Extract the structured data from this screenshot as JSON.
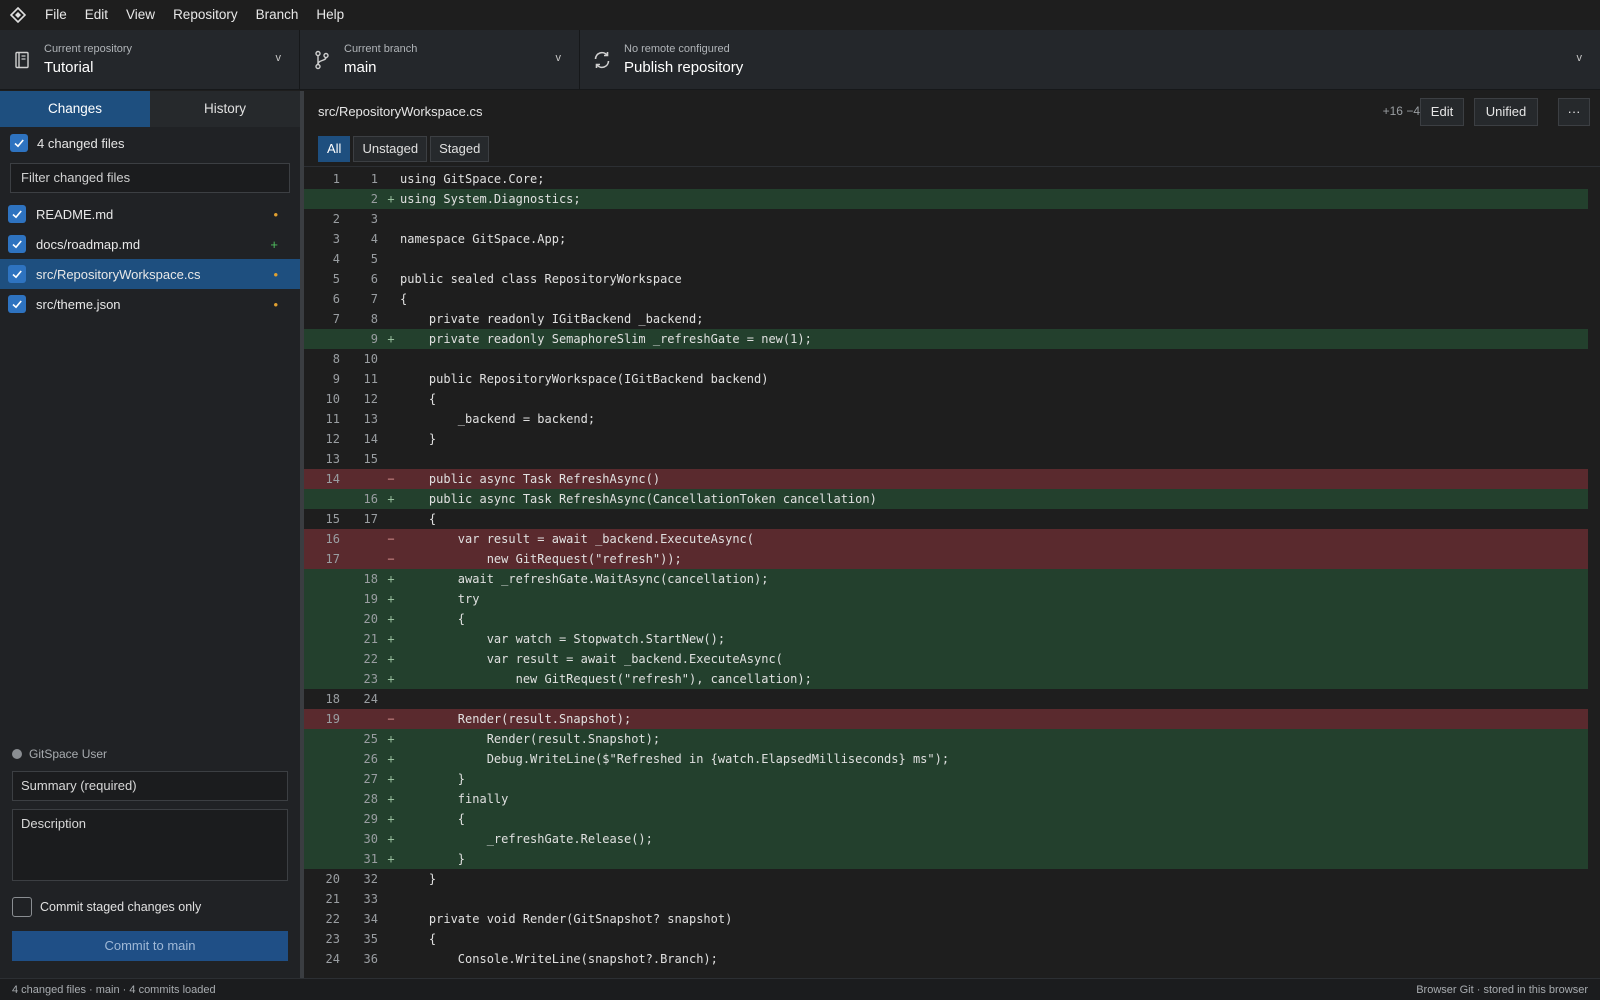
{
  "menu": [
    "File",
    "Edit",
    "View",
    "Repository",
    "Branch",
    "Help"
  ],
  "toolbar": {
    "repo": {
      "caption": "Current repository",
      "value": "Tutorial",
      "chevron": "v"
    },
    "branch": {
      "caption": "Current branch",
      "value": "main",
      "chevron": "v"
    },
    "publish": {
      "caption": "No remote configured",
      "value": "Publish repository",
      "chevron": "v"
    }
  },
  "sidebar": {
    "tabs": [
      "Changes",
      "History"
    ],
    "changed_count_label": "4 changed files",
    "filter_placeholder": "Filter changed files",
    "files": [
      {
        "name": "README.md",
        "status": "•"
      },
      {
        "name": "docs/roadmap.md",
        "status": "+"
      },
      {
        "name": "src/RepositoryWorkspace.cs",
        "status": "•"
      },
      {
        "name": "src/theme.json",
        "status": "•"
      }
    ],
    "author": "GitSpace User",
    "summary_placeholder": "Summary (required)",
    "description_placeholder": "Description",
    "staged_only_label": "Commit staged changes only",
    "commit_button": "Commit to main"
  },
  "diff": {
    "path": "src/RepositoryWorkspace.cs",
    "stats": "+16 −4",
    "edit_button": "Edit",
    "mode_button": "Unified",
    "more_button": "···",
    "view_tabs": [
      "All",
      "Unstaged",
      "Staged"
    ],
    "lines": [
      {
        "type": "ctx",
        "old": "1",
        "new": "1",
        "mark": "",
        "code": "using GitSpace.Core;"
      },
      {
        "type": "add",
        "old": "",
        "new": "2",
        "mark": "+",
        "code": "using System.Diagnostics;"
      },
      {
        "type": "ctx",
        "old": "2",
        "new": "3",
        "mark": "",
        "code": ""
      },
      {
        "type": "ctx",
        "old": "3",
        "new": "4",
        "mark": "",
        "code": "namespace GitSpace.App;"
      },
      {
        "type": "ctx",
        "old": "4",
        "new": "5",
        "mark": "",
        "code": ""
      },
      {
        "type": "ctx",
        "old": "5",
        "new": "6",
        "mark": "",
        "code": "public sealed class RepositoryWorkspace"
      },
      {
        "type": "ctx",
        "old": "6",
        "new": "7",
        "mark": "",
        "code": "{"
      },
      {
        "type": "ctx",
        "old": "7",
        "new": "8",
        "mark": "",
        "code": "    private readonly IGitBackend _backend;"
      },
      {
        "type": "add",
        "old": "",
        "new": "9",
        "mark": "+",
        "code": "    private readonly SemaphoreSlim _refreshGate = new(1);"
      },
      {
        "type": "ctx",
        "old": "8",
        "new": "10",
        "mark": "",
        "code": ""
      },
      {
        "type": "ctx",
        "old": "9",
        "new": "11",
        "mark": "",
        "code": "    public RepositoryWorkspace(IGitBackend backend)"
      },
      {
        "type": "ctx",
        "old": "10",
        "new": "12",
        "mark": "",
        "code": "    {"
      },
      {
        "type": "ctx",
        "old": "11",
        "new": "13",
        "mark": "",
        "code": "        _backend = backend;"
      },
      {
        "type": "ctx",
        "old": "12",
        "new": "14",
        "mark": "",
        "code": "    }"
      },
      {
        "type": "ctx",
        "old": "13",
        "new": "15",
        "mark": "",
        "code": ""
      },
      {
        "type": "del",
        "old": "14",
        "new": "",
        "mark": "−",
        "code": "    public async Task RefreshAsync()"
      },
      {
        "type": "add",
        "old": "",
        "new": "16",
        "mark": "+",
        "code": "    public async Task RefreshAsync(CancellationToken cancellation)"
      },
      {
        "type": "ctx",
        "old": "15",
        "new": "17",
        "mark": "",
        "code": "    {"
      },
      {
        "type": "del",
        "old": "16",
        "new": "",
        "mark": "−",
        "code": "        var result = await _backend.ExecuteAsync("
      },
      {
        "type": "del",
        "old": "17",
        "new": "",
        "mark": "−",
        "code": "            new GitRequest(\"refresh\"));"
      },
      {
        "type": "add",
        "old": "",
        "new": "18",
        "mark": "+",
        "code": "        await _refreshGate.WaitAsync(cancellation);"
      },
      {
        "type": "add",
        "old": "",
        "new": "19",
        "mark": "+",
        "code": "        try"
      },
      {
        "type": "add",
        "old": "",
        "new": "20",
        "mark": "+",
        "code": "        {"
      },
      {
        "type": "add",
        "old": "",
        "new": "21",
        "mark": "+",
        "code": "            var watch = Stopwatch.StartNew();"
      },
      {
        "type": "add",
        "old": "",
        "new": "22",
        "mark": "+",
        "code": "            var result = await _backend.ExecuteAsync("
      },
      {
        "type": "add",
        "old": "",
        "new": "23",
        "mark": "+",
        "code": "                new GitRequest(\"refresh\"), cancellation);"
      },
      {
        "type": "ctx",
        "old": "18",
        "new": "24",
        "mark": "",
        "code": ""
      },
      {
        "type": "del",
        "old": "19",
        "new": "",
        "mark": "−",
        "code": "        Render(result.Snapshot);"
      },
      {
        "type": "add",
        "old": "",
        "new": "25",
        "mark": "+",
        "code": "            Render(result.Snapshot);"
      },
      {
        "type": "add",
        "old": "",
        "new": "26",
        "mark": "+",
        "code": "            Debug.WriteLine($\"Refreshed in {watch.ElapsedMilliseconds} ms\");"
      },
      {
        "type": "add",
        "old": "",
        "new": "27",
        "mark": "+",
        "code": "        }"
      },
      {
        "type": "add",
        "old": "",
        "new": "28",
        "mark": "+",
        "code": "        finally"
      },
      {
        "type": "add",
        "old": "",
        "new": "29",
        "mark": "+",
        "code": "        {"
      },
      {
        "type": "add",
        "old": "",
        "new": "30",
        "mark": "+",
        "code": "            _refreshGate.Release();"
      },
      {
        "type": "add",
        "old": "",
        "new": "31",
        "mark": "+",
        "code": "        }"
      },
      {
        "type": "ctx",
        "old": "20",
        "new": "32",
        "mark": "",
        "code": "    }"
      },
      {
        "type": "ctx",
        "old": "21",
        "new": "33",
        "mark": "",
        "code": ""
      },
      {
        "type": "ctx",
        "old": "22",
        "new": "34",
        "mark": "",
        "code": "    private void Render(GitSnapshot? snapshot)"
      },
      {
        "type": "ctx",
        "old": "23",
        "new": "35",
        "mark": "",
        "code": "    {"
      },
      {
        "type": "ctx",
        "old": "24",
        "new": "36",
        "mark": "",
        "code": "        Console.WriteLine(snapshot?.Branch);"
      }
    ]
  },
  "statusbar": {
    "left": "4 changed files  ·  main  ·  4 commits loaded",
    "right": "Browser Git · stored in this browser"
  },
  "colors": {
    "accent": "#1e4f7f",
    "added_bg": "#23402d",
    "removed_bg": "#5a2a2e",
    "modified": "#e0a030",
    "added": "#4fbf5f"
  },
  "icons": {
    "app": "diamond-logo-icon",
    "repo": "repo-book-icon",
    "branch": "git-branch-icon",
    "publish": "sync-icon",
    "check": "check-icon"
  }
}
